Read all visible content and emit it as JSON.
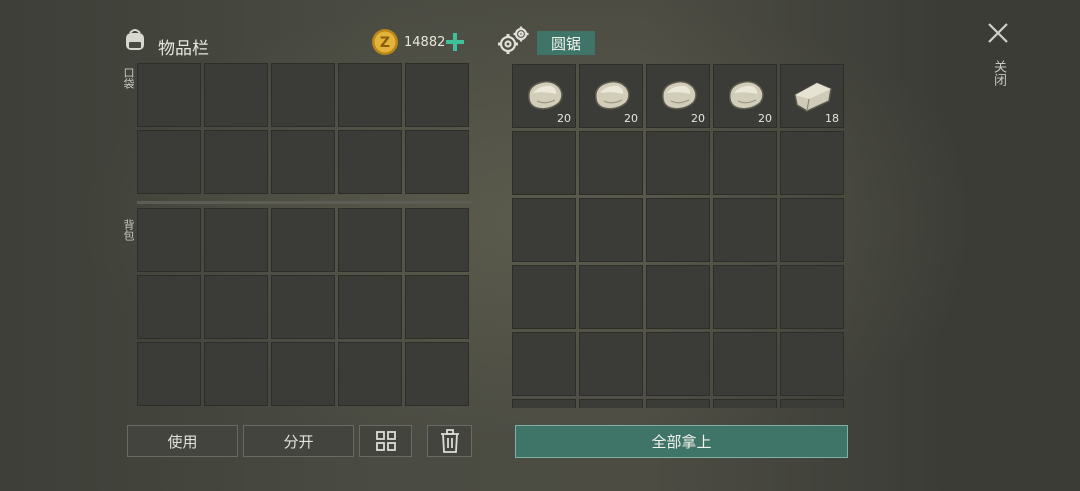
{
  "header": {
    "inventory_title": "物品栏",
    "coins": "14882",
    "machine_name": "圆锯",
    "close_label": "关闭"
  },
  "sections": {
    "pocket_label": "口袋",
    "backpack_label": "背包"
  },
  "machine_items": [
    {
      "name": "stone",
      "count": "20"
    },
    {
      "name": "stone",
      "count": "20"
    },
    {
      "name": "stone",
      "count": "20"
    },
    {
      "name": "stone",
      "count": "20"
    },
    {
      "name": "stone-block",
      "count": "18"
    }
  ],
  "buttons": {
    "use": "使用",
    "split": "分开",
    "take_all": "全部拿上"
  },
  "icons": {
    "backpack": "backpack-icon",
    "coin": "coin-icon",
    "add": "plus-icon",
    "gears": "gears-icon",
    "close": "close-icon",
    "sort": "grid-sort-icon",
    "delete": "trash-icon"
  },
  "colors": {
    "accent_green": "#3f7468",
    "plus_green": "#3fbf9a",
    "coin_gold": "#d4a62a"
  }
}
